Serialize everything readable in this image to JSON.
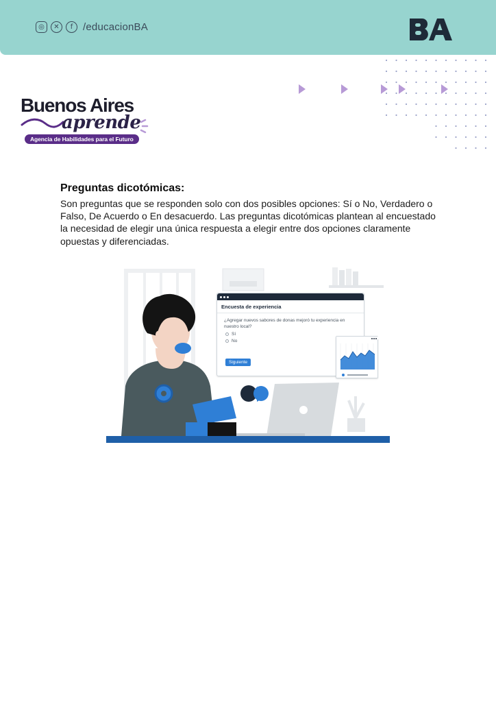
{
  "header": {
    "handle": "/educacionBA",
    "logo_text": "BA",
    "social_icons": [
      "instagram-icon",
      "x-icon",
      "facebook-icon"
    ],
    "colors": {
      "band": "#97d4cf",
      "logo": "#1e2a38"
    }
  },
  "brand": {
    "title": "Buenos Aires",
    "script": "aprende",
    "tagline": "Agencia de Habilidades para el Futuro",
    "colors": {
      "purple": "#5a2d88",
      "accent": "#b79ad6"
    }
  },
  "section": {
    "heading": "Preguntas dicotómicas:",
    "body": "Son preguntas que se responden solo con dos posibles opciones: Sí o No, Verdadero o Falso, De Acuerdo o En desacuerdo. Las preguntas dicotómicas plantean al encuestado la necesidad de elegir una única respuesta a elegir entre dos opciones claramente opuestas y diferenciadas."
  },
  "illustration": {
    "survey": {
      "title": "Encuesta de experiencia",
      "question": "¿Agregar nuevos sabores de donas mejoró tu experiencia en nuestro local?",
      "options": [
        "Sí",
        "No"
      ],
      "button": "Siguiente"
    },
    "colors": {
      "blue": "#2f7fd6",
      "dark": "#1e2a3a",
      "floor": "#1f5fa8"
    }
  }
}
